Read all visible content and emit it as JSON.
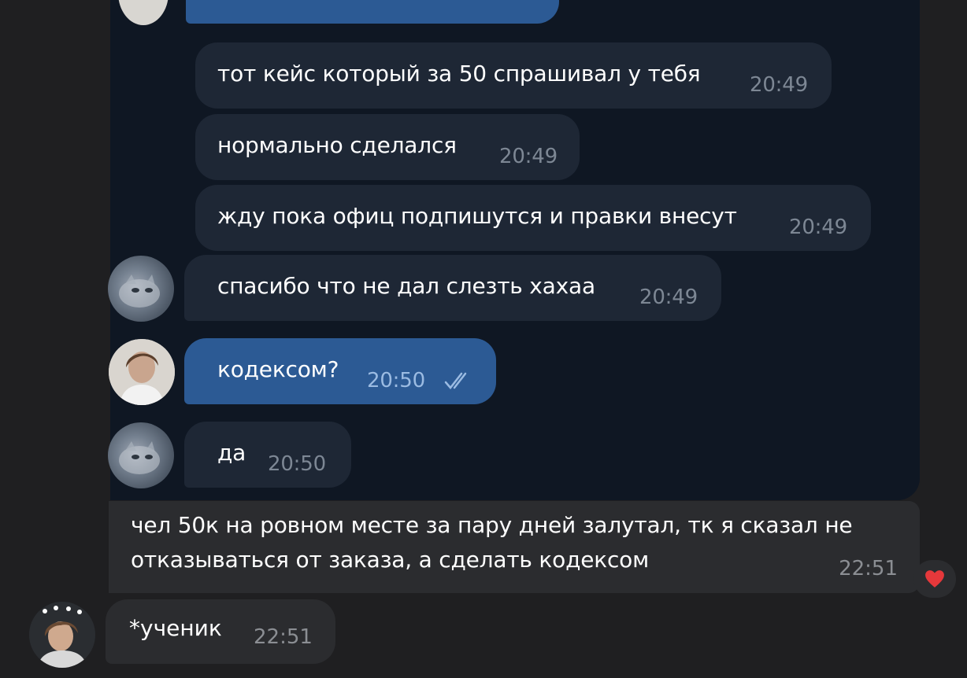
{
  "chat": {
    "messages": [
      {
        "text": "тот кейс который за 50 спрашивал у тебя",
        "time": "20:49"
      },
      {
        "text": "нормально сделался",
        "time": "20:49"
      },
      {
        "text": "жду пока офиц подпишутся и правки внесут",
        "time": "20:49"
      },
      {
        "text": "спасибо что не дал слезть хахаа",
        "time": "20:49"
      },
      {
        "text": "кодексом?",
        "time": "20:50"
      },
      {
        "text": "да",
        "time": "20:50"
      }
    ],
    "forwarded_message": {
      "line1": "чел 50к на ровном месте за пару дней залутал, тк я сказал не",
      "line2": "отказываться от заказа, а сделать кодексом",
      "time": "22:51",
      "reaction_icon": "heart"
    },
    "note_message": {
      "text": "*ученик",
      "time": "22:51"
    }
  },
  "colors": {
    "page_bg": "#1f1f21",
    "chat_bg": "#0f1723",
    "incoming_bubble": "#1e2735",
    "outgoing_bubble": "#2c5a94",
    "gray_bubble": "#2b2c2f",
    "heart": "#e5383b"
  }
}
